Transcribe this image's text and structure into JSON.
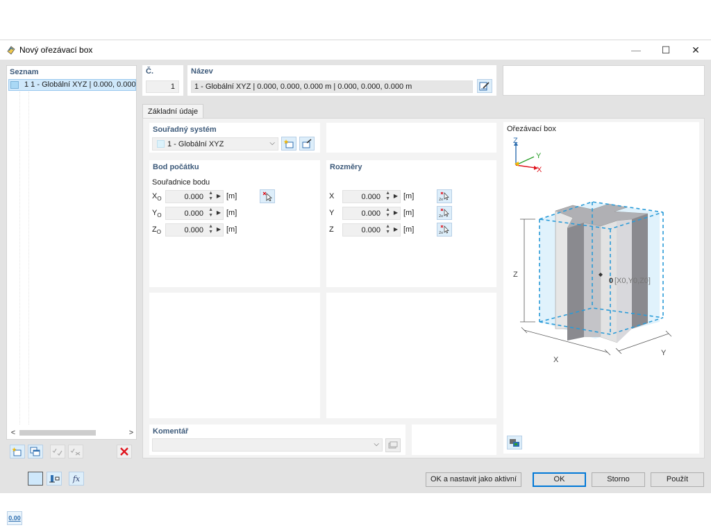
{
  "window": {
    "title": "Nový ořezávací box",
    "minimize_glyph": "—",
    "maximize_glyph": "☐",
    "close_glyph": "✕"
  },
  "list": {
    "header": "Seznam",
    "items": [
      {
        "label": "1  1 - Globální XYZ | 0.000, 0.000, 0"
      }
    ],
    "scroll_left": "<",
    "scroll_right": ">"
  },
  "number": {
    "label": "Č.",
    "value": "1"
  },
  "name": {
    "label": "Název",
    "value": "1 - Globální XYZ | 0.000, 0.000, 0.000 m | 0.000, 0.000, 0.000 m"
  },
  "tabs": [
    {
      "label": "Základní údaje",
      "active": true
    }
  ],
  "coord_system": {
    "label": "Souřadný systém",
    "value": "1 - Globální XYZ"
  },
  "origin": {
    "label": "Bod počátku",
    "sublabel": "Souřadnice bodu",
    "rows": [
      {
        "label": "X",
        "sub": "O",
        "value": "0.000",
        "unit": "[m]"
      },
      {
        "label": "Y",
        "sub": "O",
        "value": "0.000",
        "unit": "[m]"
      },
      {
        "label": "Z",
        "sub": "O",
        "value": "0.000",
        "unit": "[m]"
      }
    ]
  },
  "dimensions": {
    "label": "Rozměry",
    "rows": [
      {
        "label": "X",
        "value": "0.000",
        "unit": "[m]"
      },
      {
        "label": "Y",
        "value": "0.000",
        "unit": "[m]"
      },
      {
        "label": "Z",
        "value": "0.000",
        "unit": "[m]"
      }
    ]
  },
  "comment": {
    "label": "Komentář",
    "value": ""
  },
  "preview": {
    "title": "Ořezávací box",
    "axis_z": "Z",
    "axis_y": "Y",
    "axis_x": "X",
    "dim_z": "Z",
    "dim_x": "X",
    "dim_y": "Y",
    "origin_label": "0",
    "origin_coords": "[X0,Y0,Z0]"
  },
  "buttons": {
    "ok_set_active": "OK a nastavit jako aktivní",
    "ok": "OK",
    "cancel": "Storno",
    "apply": "Použít"
  },
  "icons": {
    "zero_value_label": "0.00",
    "function_label": "fx"
  },
  "colors": {
    "section_label": "#3d5a7a",
    "selection": "#cfe8fb",
    "accent": "#0078d7",
    "delete": "#e0141e",
    "box_edge": "#2a9bd8"
  }
}
